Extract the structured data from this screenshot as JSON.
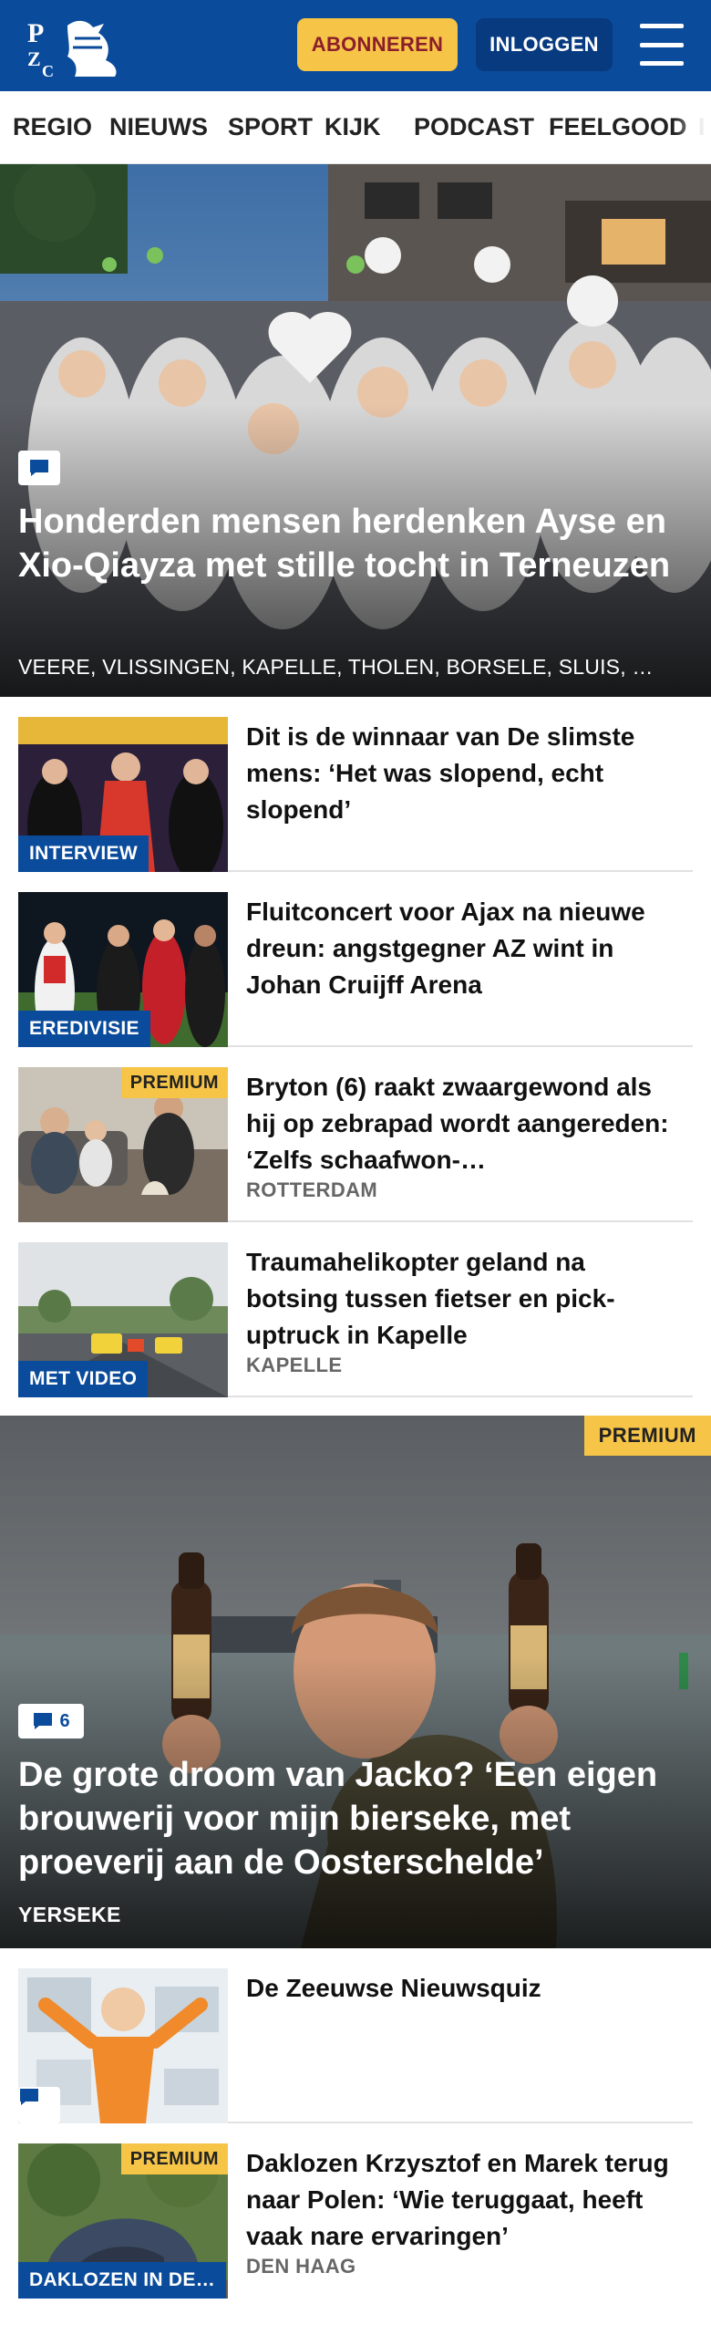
{
  "header": {
    "logo_text": "PZC",
    "subscribe_label": "ABONNEREN",
    "login_label": "INLOGGEN",
    "menu_icon": "hamburger-icon",
    "colors": {
      "brand": "#0a4b9b",
      "accent": "#f6c447"
    }
  },
  "nav": {
    "items": [
      "REGIO",
      "NIEUWS",
      "SPORT",
      "KIJK",
      "PODCAST",
      "FEELGOOD"
    ]
  },
  "hero": {
    "title": "Honderden mensen herdenken Ayse en Xio-Qiayza met stille tocht in Terneuzen",
    "tags": "VEERE, VLISSINGEN, KAPELLE, THOLEN, BORSELE, SLUIS, …",
    "comment_icon": "comment-icon"
  },
  "articles": [
    {
      "title": "Dit is de winnaar van De slimste mens: ‘Het was slopend, echt slopend’",
      "label": "INTERVIEW",
      "premium": "",
      "location": ""
    },
    {
      "title": "Fluitconcert voor Ajax na nieuwe dreun: angstgegner AZ wint in Johan Cruijff Arena",
      "label": "EREDIVISIE",
      "premium": "",
      "location": ""
    },
    {
      "title": "Bryton (6) raakt zwaargewond als hij op zebrapad wordt aangereden: ‘Zelfs schaafwon-…",
      "label": "",
      "premium": "PREMIUM",
      "location": "ROTTERDAM"
    },
    {
      "title": "Traumahelikopter geland na botsing tussen fietser en pick-uptruck in Kapelle",
      "label": "MET VIDEO",
      "premium": "",
      "location": "KAPELLE"
    }
  ],
  "feature": {
    "premium": "PREMIUM",
    "comment_count": "6",
    "title": "De grote droom van Jacko? ‘Een eigen brouwerij voor mijn bierseke, met proeverij aan de Oosterschelde’",
    "location": "YERSEKE"
  },
  "articles2": [
    {
      "title": "De Zeeuwse Nieuwsquiz",
      "label": "",
      "premium": "",
      "location": ""
    },
    {
      "title": "Daklozen Krzysztof en Marek terug naar Polen: ‘Wie teruggaat, heeft vaak nare ervaringen’",
      "label": "DAKLOZEN IN DE…",
      "premium": "PREMIUM",
      "location": "DEN HAAG"
    }
  ]
}
